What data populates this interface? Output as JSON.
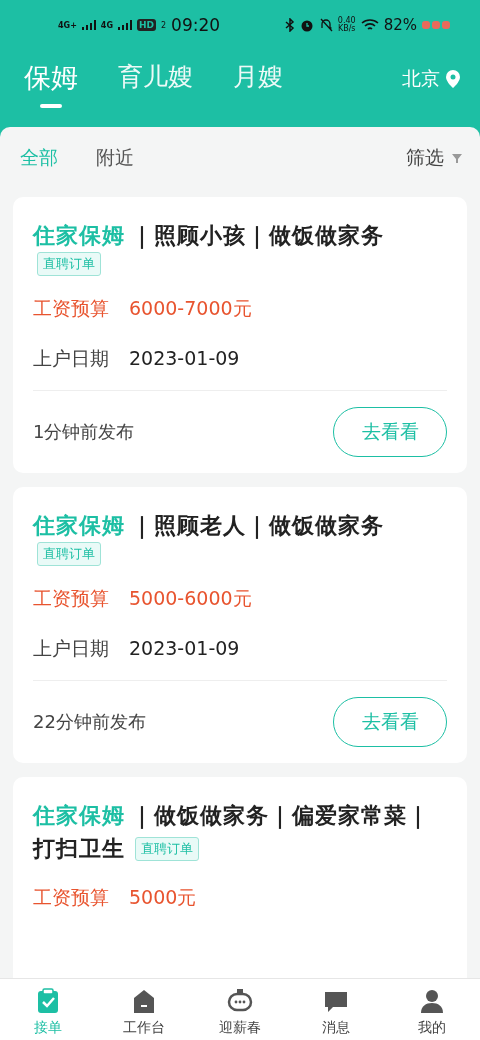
{
  "status_bar": {
    "networks": [
      "4G+",
      "4G"
    ],
    "hd": "HD",
    "hd_sub": "2",
    "time": "09:20",
    "speed": "0.40",
    "speed_unit": "KB/s",
    "battery": "82%"
  },
  "tabs": [
    {
      "label": "保姆",
      "selected": true
    },
    {
      "label": "育儿嫂",
      "selected": false
    },
    {
      "label": "月嫂",
      "selected": false
    }
  ],
  "city": "北京",
  "filters": [
    {
      "label": "全部",
      "selected": true
    },
    {
      "label": "附近",
      "selected": false
    }
  ],
  "filter_button": "筛选",
  "orders": [
    {
      "category": "住家保姆",
      "title": [
        "｜照顾小孩｜做饭做家务"
      ],
      "tag": "直聘订单",
      "salary_label": "工资预算",
      "salary": "6000-7000元",
      "date_label": "上户日期",
      "date": "2023-01-09",
      "posted": "1分钟前发布",
      "action": "去看看"
    },
    {
      "category": "住家保姆",
      "title": [
        "｜照顾老人｜做饭做家务"
      ],
      "tag": "直聘订单",
      "salary_label": "工资预算",
      "salary": "5000-6000元",
      "date_label": "上户日期",
      "date": "2023-01-09",
      "posted": "22分钟前发布",
      "action": "去看看"
    },
    {
      "category": "住家保姆",
      "title": [
        "｜做饭做家务｜偏爱家常菜｜",
        "打扫卫生"
      ],
      "tag": "直聘订单",
      "salary_label": "工资预算",
      "salary": "5000元"
    }
  ],
  "bottom_nav": [
    {
      "kind": "orders",
      "label": "接单",
      "selected": true
    },
    {
      "kind": "workbench",
      "label": "工作台",
      "selected": false
    },
    {
      "kind": "festival",
      "label": "迎薪春",
      "selected": false
    },
    {
      "kind": "messages",
      "label": "消息",
      "selected": false
    },
    {
      "kind": "profile",
      "label": "我的",
      "selected": false
    }
  ]
}
